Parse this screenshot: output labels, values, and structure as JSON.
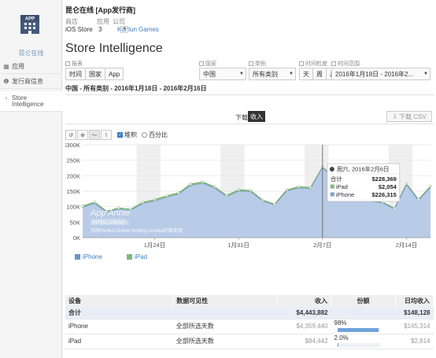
{
  "sidebar": {
    "app_name": "昆仑在线",
    "items": [
      {
        "label": "应用",
        "icon": "grid-icon"
      },
      {
        "label": "发行商信息",
        "icon": "info-icon"
      },
      {
        "label": "Store Intelligence",
        "icon": "chevron-right-icon"
      }
    ],
    "icon_text": "APP"
  },
  "header": {
    "app_title": "昆仑在线 [App发行商]",
    "meta_labels": [
      "商店",
      "应用",
      "公司"
    ],
    "store": "iOS Store",
    "apps_count": "3",
    "company": "Kunlun Games"
  },
  "page": {
    "title": "Store Intelligence",
    "subtitle": "中国 - 所有类别 - 2016年1月18日 - 2016年2月16日"
  },
  "filters": {
    "report_label": "报表",
    "report_buttons": [
      "时间",
      "国家",
      "App"
    ],
    "country_label": "国家",
    "country_value": "中国",
    "category_label": "类别",
    "category_value": "所有类别",
    "granularity_label": "时间粒度",
    "granularity_buttons": [
      "天",
      "周",
      "月"
    ],
    "range_label": "时间范围",
    "range_value": "2016年1月18日 - 2016年2..."
  },
  "downloads": {
    "label": "下载",
    "active": "收入",
    "csv": "下载 CSV"
  },
  "chart_controls": {
    "stack_label": "堆积",
    "percent_label": "百分比",
    "stacked": true
  },
  "colors": {
    "iphone": "#a9bee0",
    "ipad": "#7fb77e",
    "accent": "#3a7fc1"
  },
  "chart_data": {
    "type": "area",
    "ylabel": "",
    "y_tick_labels": [
      "$300K",
      "250K",
      "200K",
      "150K",
      "100K",
      "50K",
      "0K"
    ],
    "ylim": [
      0,
      300000
    ],
    "x_tick_labels": [
      "1月24日",
      "1月31日",
      "2月7日",
      "2月14日"
    ],
    "x": [
      "1/18",
      "1/19",
      "1/20",
      "1/21",
      "1/22",
      "1/23",
      "1/24",
      "1/25",
      "1/26",
      "1/27",
      "1/28",
      "1/29",
      "1/30",
      "1/31",
      "2/1",
      "2/2",
      "2/3",
      "2/4",
      "2/5",
      "2/6",
      "2/7",
      "2/8",
      "2/9",
      "2/10",
      "2/11",
      "2/12",
      "2/13",
      "2/14",
      "2/15",
      "2/16"
    ],
    "weekend_bands": [
      [
        5,
        6
      ],
      [
        12,
        13
      ],
      [
        19,
        20
      ],
      [
        26,
        27
      ]
    ],
    "series": [
      {
        "name": "iPhone",
        "values": [
          98000,
          110000,
          82000,
          92000,
          88000,
          110000,
          118000,
          130000,
          140000,
          168000,
          175000,
          160000,
          132000,
          150000,
          148000,
          118000,
          105000,
          150000,
          160000,
          158000,
          226315,
          188000,
          178000,
          125000,
          118000,
          112000,
          92000,
          170000,
          120000,
          162000
        ]
      },
      {
        "name": "iPad",
        "values": [
          4000,
          5000,
          3000,
          4000,
          3500,
          4000,
          4500,
          5000,
          4500,
          5000,
          5000,
          4500,
          4000,
          4500,
          4500,
          3500,
          3000,
          4000,
          4500,
          4000,
          2054,
          4000,
          4000,
          3500,
          3000,
          3000,
          3000,
          4000,
          3500,
          4000
        ]
      }
    ],
    "tooltip": {
      "date": "周六, 2016年2月6日",
      "total_label": "合计",
      "total_value": "$228,369",
      "rows": [
        {
          "name": "iPad",
          "value": "$2,054"
        },
        {
          "name": "iPhone",
          "value": "$226,315"
        }
      ]
    },
    "watermark": [
      "App Annie",
      "INTELLIGENCE",
      "仅限Perfect Online Holding Limited内部使用"
    ],
    "legend": [
      "iPhone",
      "iPad"
    ]
  },
  "table": {
    "headers": [
      "设备",
      "数据可见性",
      "收入",
      "份额",
      "日均收入"
    ],
    "total": {
      "label": "合计",
      "revenue": "$4,443,882",
      "daily": "$148,128"
    },
    "rows": [
      {
        "device": "iPhone",
        "visibility": "全部所选天数",
        "revenue": "$4,359,440",
        "share": "98%",
        "share_value": 0.98,
        "daily": "$145,314"
      },
      {
        "device": "iPad",
        "visibility": "全部所选天数",
        "revenue": "$84,442",
        "share": "2.0%",
        "share_value": 0.02,
        "daily": "$2,814"
      }
    ]
  }
}
